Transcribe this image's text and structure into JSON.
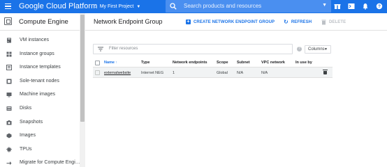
{
  "topbar": {
    "brand": "Google Cloud Platform",
    "project": "My First Project",
    "search_placeholder": "Search products and resources",
    "icons": [
      "gift-icon",
      "cloud-shell-icon",
      "notifications-icon",
      "help-icon"
    ]
  },
  "sidebar": {
    "title": "Compute Engine",
    "items": [
      {
        "label": "VM instances",
        "icon": "vm-instances-icon"
      },
      {
        "label": "Instance groups",
        "icon": "instance-groups-icon"
      },
      {
        "label": "Instance templates",
        "icon": "instance-templates-icon"
      },
      {
        "label": "Sole-tenant nodes",
        "icon": "sole-tenant-nodes-icon"
      },
      {
        "label": "Machine images",
        "icon": "machine-images-icon"
      },
      {
        "label": "Disks",
        "icon": "disks-icon"
      },
      {
        "label": "Snapshots",
        "icon": "snapshots-icon"
      },
      {
        "label": "Images",
        "icon": "images-icon"
      },
      {
        "label": "TPUs",
        "icon": "tpus-icon"
      },
      {
        "label": "Migrate for Compute Engi…",
        "icon": "migrate-icon"
      }
    ]
  },
  "main": {
    "title": "Network Endpoint Group",
    "actions": {
      "create": "CREATE NETWORK ENDPOINT GROUP",
      "refresh": "REFRESH",
      "delete": "DELETE"
    },
    "filter_placeholder": "Filter resources",
    "columns_label": "Columns",
    "table": {
      "headers": {
        "name": "Name",
        "type": "Type",
        "endpoints": "Network endpoints",
        "scope": "Scope",
        "subnet": "Subnet",
        "vpc": "VPC network",
        "inuse": "In use by"
      },
      "rows": [
        {
          "name": "externalwebsite",
          "type": "Internet NEG",
          "endpoints": "1",
          "scope": "Global",
          "subnet": "N/A",
          "vpc": "N/A",
          "inuse": ""
        }
      ]
    }
  },
  "colors": {
    "header_blue": "#1a73e8",
    "link_blue": "#1a73e8",
    "row_highlight": "#f1f3f4"
  }
}
